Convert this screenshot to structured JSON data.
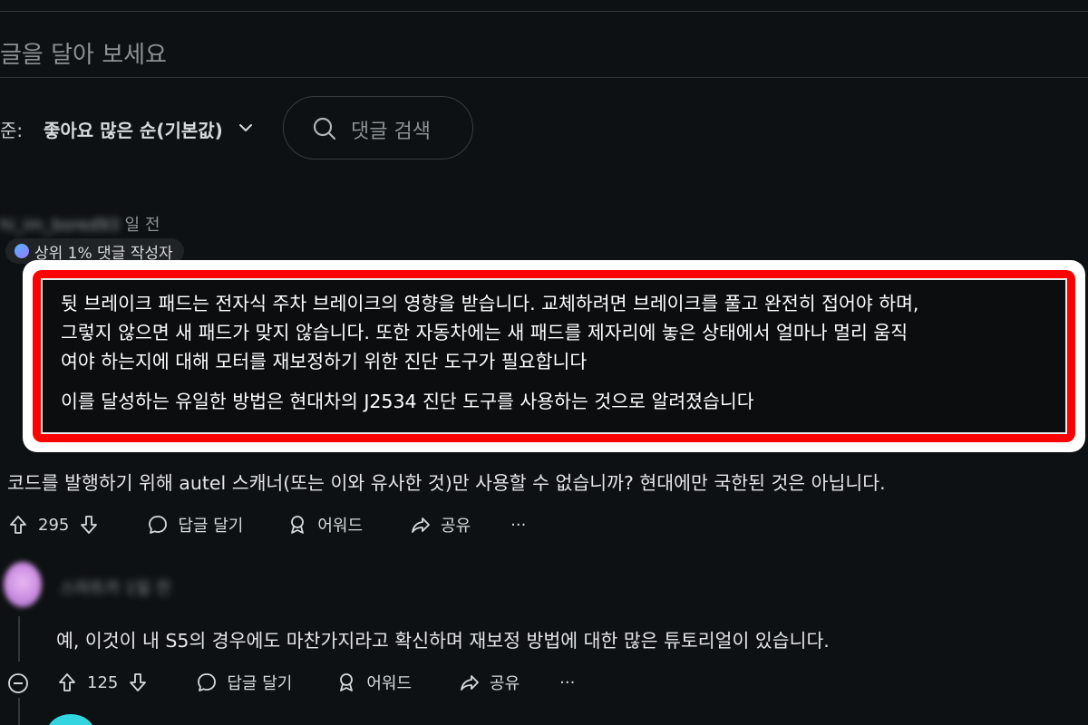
{
  "comment_input": {
    "placeholder": "글을 달아 보세요"
  },
  "sort": {
    "label": "준:",
    "value": "좋아요 많은 순(기본값)"
  },
  "search": {
    "placeholder": "댓글 검색"
  },
  "comment1": {
    "username_blurred": "hi_im_bored93",
    "time_suffix": "일 전",
    "badge": "상위 1% 댓글 작성자",
    "paragraph1": [
      "뒷 브레이크 패드는 전자식 주차 브레이크의 영향을 받습니다. 교체하려면 브레이크를 풀고 완전히 접어야 하며,",
      "그렇지 않으면 새 패드가 맞지 않습니다. 또한 자동차에는 새 패드를 제자리에 놓은 상태에서 얼마나 멀리 움직",
      "여야 하는지에 대해 모터를 재보정하기 위한 진단 도구가 필요합니다"
    ],
    "paragraph2": "이를 달성하는 유일한 방법은 현대차의 J2534 진단 도구를 사용하는 것으로 알려졌습니다",
    "paragraph3": "코드를 발행하기 위해 autel 스캐너(또는 이와 유사한 것)만 사용할 수 없습니까? 현대에만 국한된 것은 아닙니다.",
    "votes": "295",
    "reply": "답글 달기",
    "award": "어워드",
    "share": "공유",
    "more": "···"
  },
  "comment2": {
    "username_blurred": "스마트카",
    "time_suffix": "1일 전",
    "text": "예, 이것이 내 S5의 경우에도 마찬가지라고 확신하며 재보정 방법에 대한 많은 튜토리얼이 있습니다.",
    "votes": "125",
    "reply": "답글 달기",
    "award": "어워드",
    "share": "공유",
    "more": "···"
  },
  "colors": {
    "background": "#0e1113",
    "highlight_border": "#ff0000",
    "text": "#d7dadc",
    "muted": "#8b9296"
  }
}
